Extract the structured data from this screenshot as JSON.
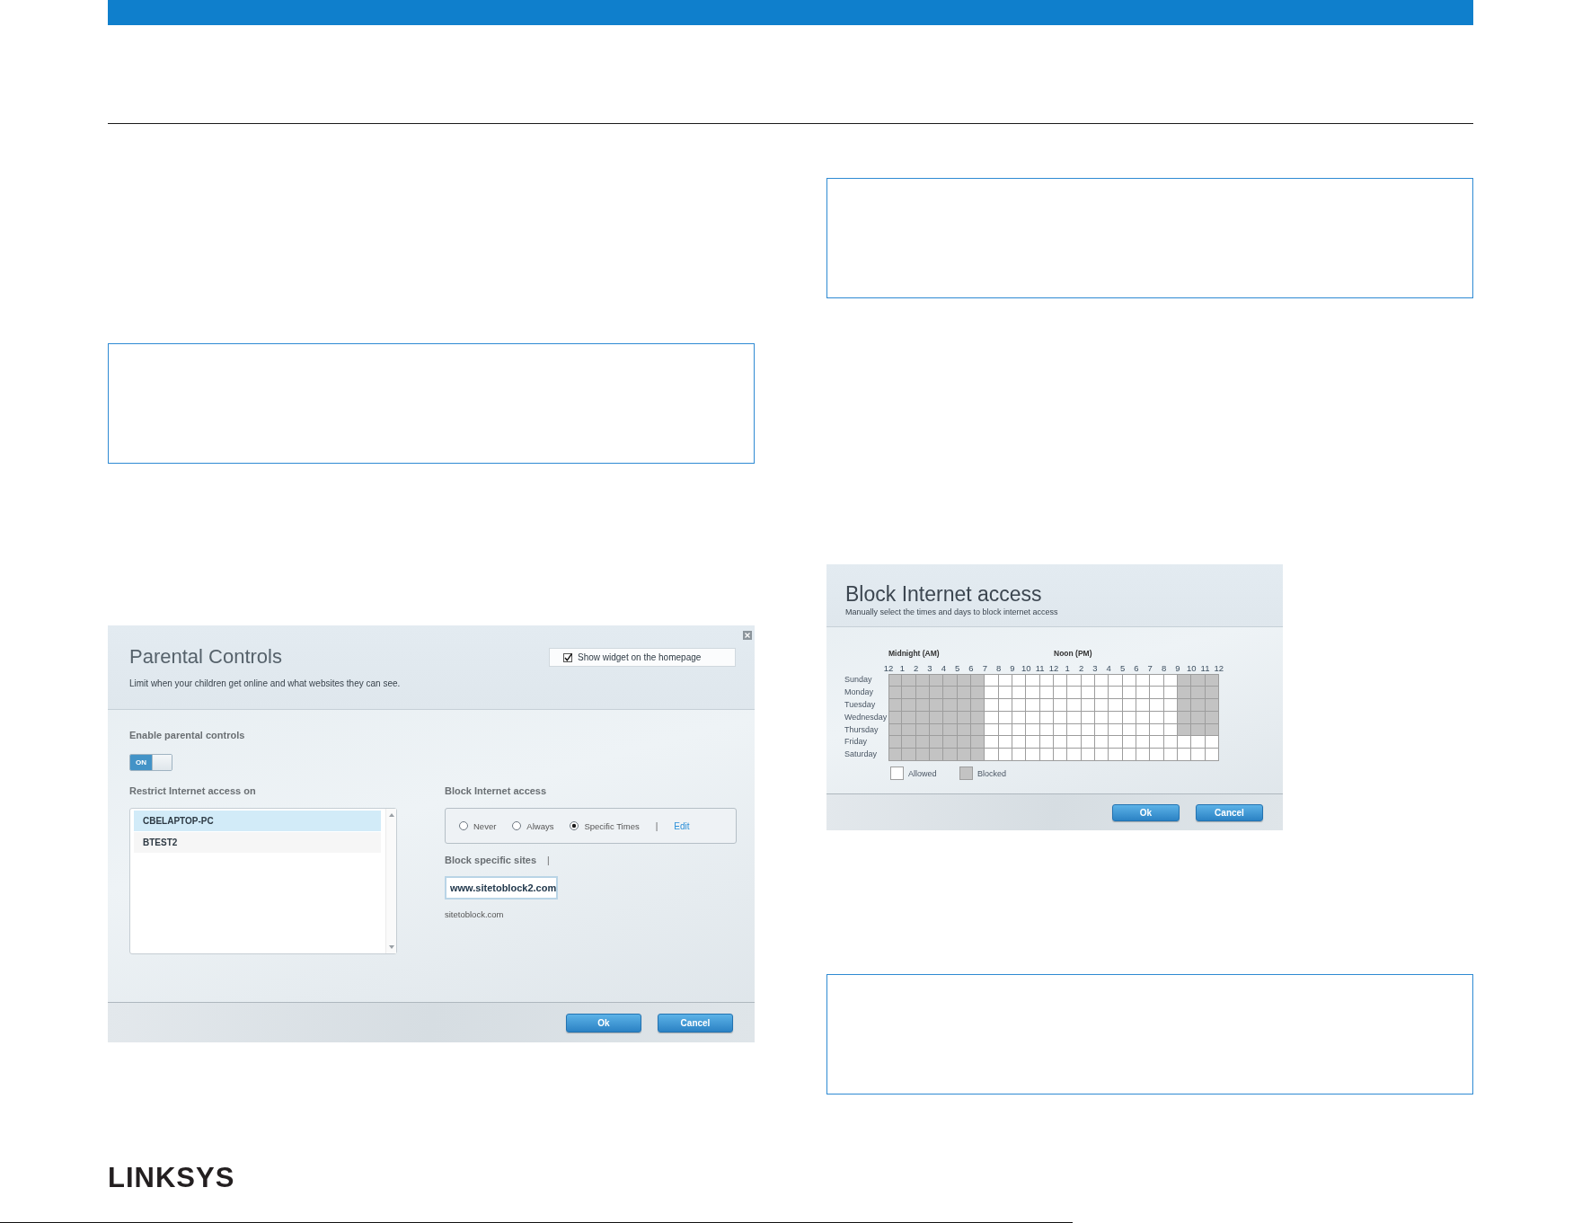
{
  "left_column": {
    "blocks": [
      {
        "kind": "note"
      },
      {
        "kind": "parental_controls",
        "title": "Parental Controls",
        "subtitle": "Limit when your children get online and what websites they can see.",
        "show_widget": {
          "label": "Show widget on the homepage",
          "checked": true
        },
        "enable": {
          "label": "Enable parental controls",
          "toggle_label": "ON",
          "on": true
        },
        "devices": {
          "label": "Restrict Internet access on",
          "items": [
            {
              "name": "CBELAPTOP-PC",
              "selected": true
            },
            {
              "name": "BTEST2",
              "selected": false
            }
          ]
        },
        "block_access": {
          "label": "Block Internet access",
          "options": [
            {
              "label": "Never",
              "selected": false
            },
            {
              "label": "Always",
              "selected": false
            },
            {
              "label": "Specific Times",
              "selected": true
            }
          ],
          "separator": "|",
          "edit_link": "Edit"
        },
        "block_sites": {
          "label": "Block specific sites",
          "separator": "|",
          "input_value": "www.sitetoblock2.com",
          "sites": [
            "sitetoblock.com"
          ]
        },
        "buttons": [
          "Ok",
          "Cancel"
        ]
      }
    ]
  },
  "right_column": {
    "blocks": [
      {
        "kind": "note"
      },
      {
        "kind": "block_schedule",
        "title": "Block Internet access",
        "subtitle": "Manually select the times and days to block internet access",
        "period_labels": [
          "Midnight (AM)",
          "Noon (PM)"
        ],
        "hours": [
          "12",
          "1",
          "2",
          "3",
          "4",
          "5",
          "6",
          "7",
          "8",
          "9",
          "10",
          "11",
          "12",
          "1",
          "2",
          "3",
          "4",
          "5",
          "6",
          "7",
          "8",
          "9",
          "10",
          "11",
          "12"
        ],
        "days": [
          {
            "name": "Sunday",
            "blocked": [
              true,
              true,
              true,
              true,
              true,
              true,
              true,
              false,
              false,
              false,
              false,
              false,
              false,
              false,
              false,
              false,
              false,
              false,
              false,
              false,
              false,
              true,
              true,
              true
            ]
          },
          {
            "name": "Monday",
            "blocked": [
              true,
              true,
              true,
              true,
              true,
              true,
              true,
              false,
              false,
              false,
              false,
              false,
              false,
              false,
              false,
              false,
              false,
              false,
              false,
              false,
              false,
              true,
              true,
              true
            ]
          },
          {
            "name": "Tuesday",
            "blocked": [
              true,
              true,
              true,
              true,
              true,
              true,
              true,
              false,
              false,
              false,
              false,
              false,
              false,
              false,
              false,
              false,
              false,
              false,
              false,
              false,
              false,
              true,
              true,
              true
            ]
          },
          {
            "name": "Wednesday",
            "blocked": [
              true,
              true,
              true,
              true,
              true,
              true,
              true,
              false,
              false,
              false,
              false,
              false,
              false,
              false,
              false,
              false,
              false,
              false,
              false,
              false,
              false,
              true,
              true,
              true
            ]
          },
          {
            "name": "Thursday",
            "blocked": [
              true,
              true,
              true,
              true,
              true,
              true,
              true,
              false,
              false,
              false,
              false,
              false,
              false,
              false,
              false,
              false,
              false,
              false,
              false,
              false,
              false,
              true,
              true,
              true
            ]
          },
          {
            "name": "Friday",
            "blocked": [
              true,
              true,
              true,
              true,
              true,
              true,
              true,
              false,
              false,
              false,
              false,
              false,
              false,
              false,
              false,
              false,
              false,
              false,
              false,
              false,
              false,
              false,
              false,
              false
            ]
          },
          {
            "name": "Saturday",
            "blocked": [
              true,
              true,
              true,
              true,
              true,
              true,
              true,
              false,
              false,
              false,
              false,
              false,
              false,
              false,
              false,
              false,
              false,
              false,
              false,
              false,
              false,
              false,
              false,
              false
            ]
          }
        ],
        "legend": [
          {
            "label": "Allowed",
            "kind": "allowed"
          },
          {
            "label": "Blocked",
            "kind": "blocked"
          }
        ],
        "buttons": [
          "Ok",
          "Cancel"
        ]
      },
      {
        "kind": "note"
      }
    ]
  },
  "footer": {
    "logo": "LINKSYS"
  }
}
